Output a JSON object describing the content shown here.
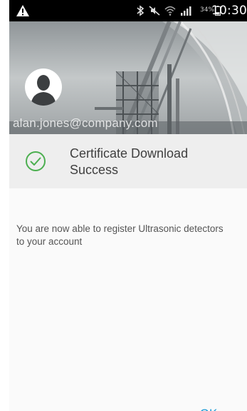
{
  "status_bar": {
    "battery_percent": "34%",
    "time": "10:30",
    "icons": [
      "warning-icon",
      "bluetooth-icon",
      "mute-icon",
      "wifi-icon",
      "signal-icon",
      "battery-icon"
    ]
  },
  "header": {
    "user_email": "alan.jones@company.com"
  },
  "dialog": {
    "title": "Certificate Download Success",
    "message": "You are now able to register Ultrasonic detectors to your account",
    "ok_label": "OK",
    "icon": "check-circle-icon"
  },
  "colors": {
    "success_green": "#4caf50",
    "accent_blue": "#1a9ad6",
    "header_bg": "#eeeeee"
  }
}
